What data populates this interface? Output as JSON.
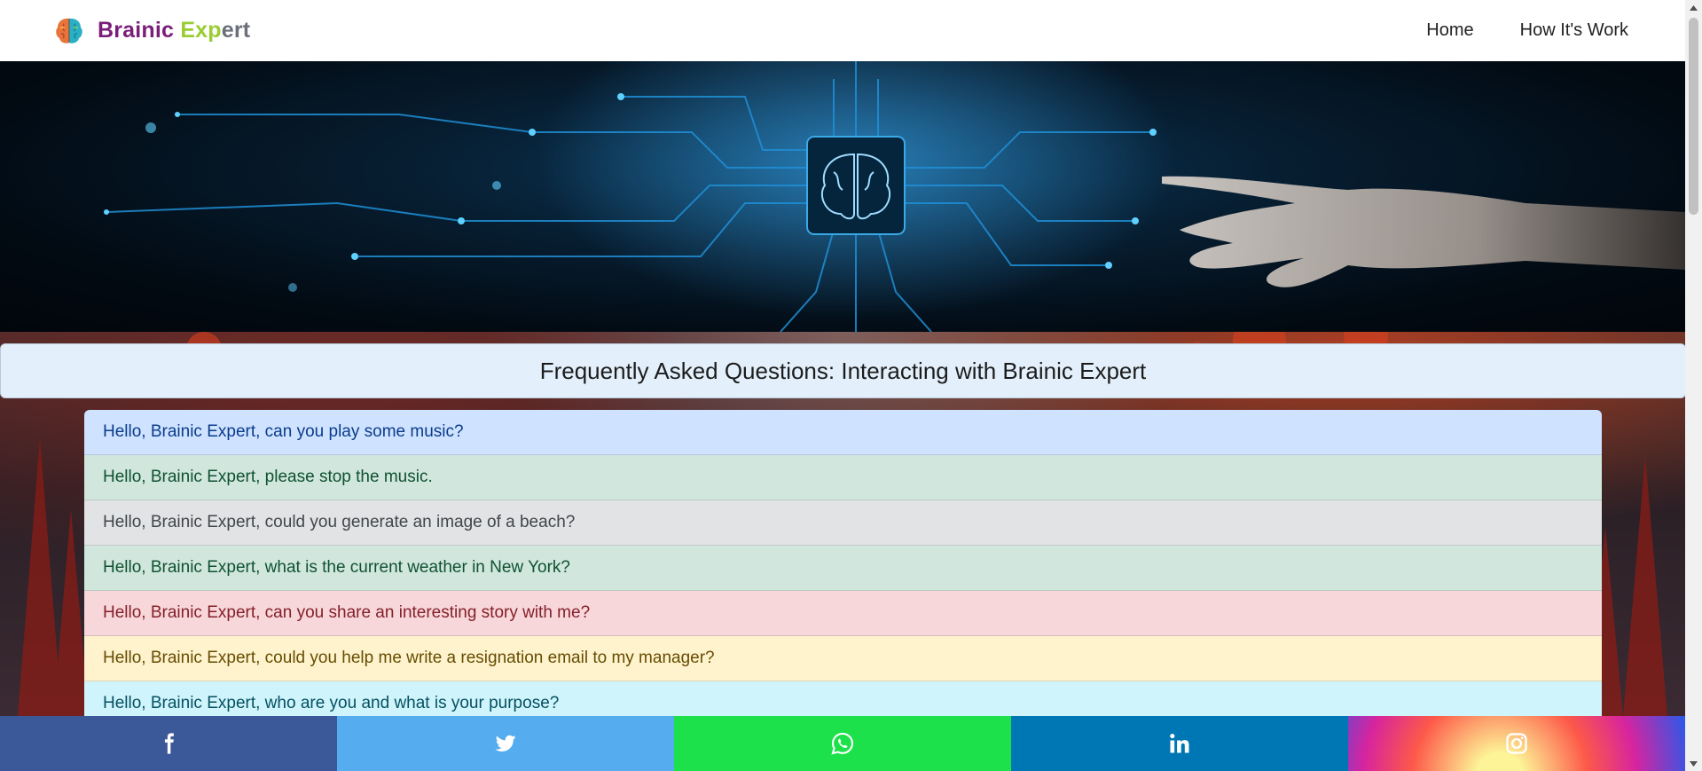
{
  "navbar": {
    "brand": {
      "part1": "Brainic",
      "part2": "Exp",
      "part3": "ert"
    },
    "links": [
      {
        "label": "Home"
      },
      {
        "label": "How It's Work"
      }
    ]
  },
  "faq": {
    "title": "Frequently Asked Questions: Interacting with Brainic Expert",
    "items": [
      {
        "text": "Hello, Brainic Expert, can you play some music?",
        "variant": "primary"
      },
      {
        "text": "Hello, Brainic Expert, please stop the music.",
        "variant": "success"
      },
      {
        "text": "Hello, Brainic Expert, could you generate an image of a beach?",
        "variant": "secondary"
      },
      {
        "text": "Hello, Brainic Expert, what is the current weather in New York?",
        "variant": "success"
      },
      {
        "text": "Hello, Brainic Expert, can you share an interesting story with me?",
        "variant": "danger"
      },
      {
        "text": "Hello, Brainic Expert, could you help me write a resignation email to my manager?",
        "variant": "warning"
      },
      {
        "text": "Hello, Brainic Expert, who are you and what is your purpose?",
        "variant": "info"
      }
    ]
  },
  "social": [
    {
      "name": "facebook-icon",
      "color": "#3b5998"
    },
    {
      "name": "twitter-icon",
      "color": "#55acee"
    },
    {
      "name": "whatsapp-icon",
      "color": "#1de14b"
    },
    {
      "name": "linkedin-icon",
      "color": "#0077b5"
    },
    {
      "name": "instagram-icon",
      "color": "gradient"
    }
  ],
  "colors": {
    "brand_purple": "#7a1e7a",
    "brand_green": "#9acd32",
    "brand_gray": "#6b6f7a",
    "title_bar": "#e3f0fb"
  }
}
